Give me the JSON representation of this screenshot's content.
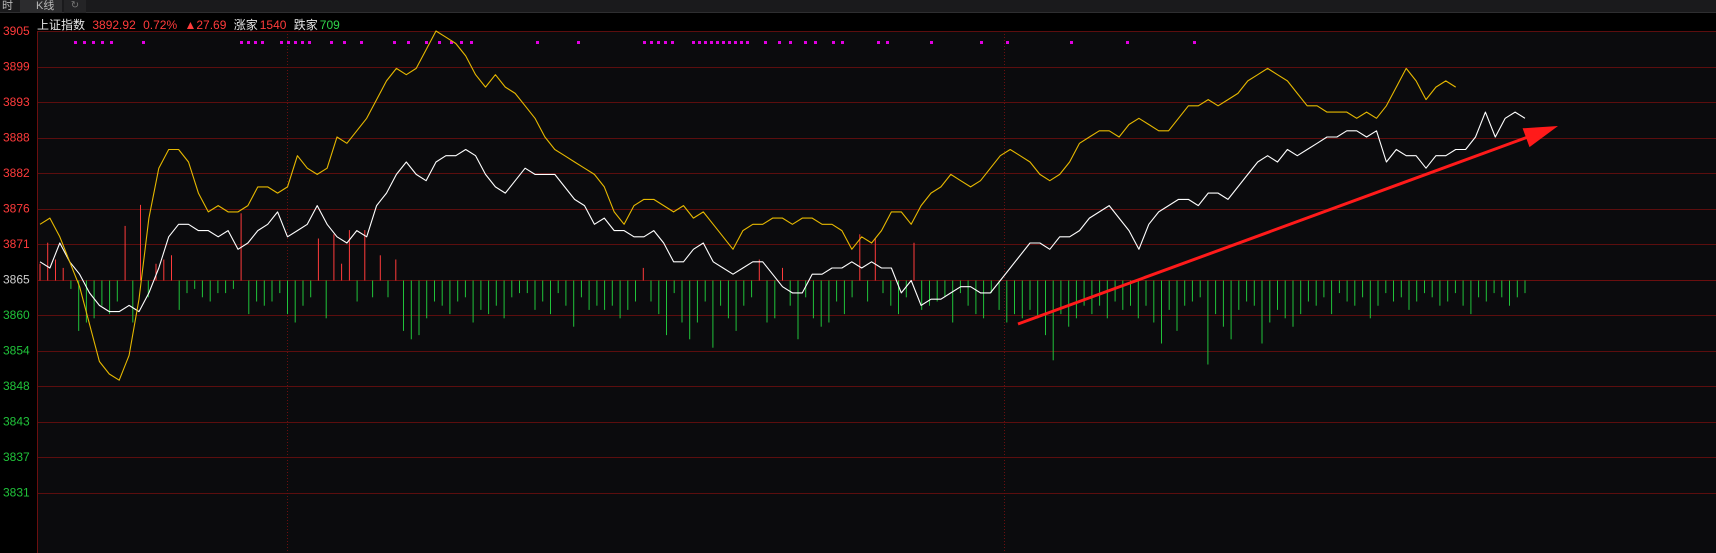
{
  "tabs": [
    {
      "label": "时"
    },
    {
      "label": "K线"
    },
    {
      "label": "↻"
    }
  ],
  "header": {
    "index_name": "上证指数",
    "price": "3892.92",
    "change_pct": "0.72%",
    "change_pts": "▲27.69",
    "advancers_label": "涨家",
    "advancers": "1540",
    "decliners_label": "跌家",
    "decliners": "709"
  },
  "colors": {
    "background": "#0b0b0d",
    "grid": "#6b0f0f",
    "up": "#ff3b3b",
    "down": "#20c33a",
    "price_line": "#ffffff",
    "avg_line": "#e6b800",
    "signal_dots": "#e000e0",
    "arrow": "#ff1a1a"
  },
  "chart_data": {
    "type": "line",
    "y_ticks": [
      "3905",
      "3899",
      "3893",
      "3888",
      "3882",
      "3876",
      "3871",
      "3865",
      "3860",
      "3854",
      "3848",
      "3843",
      "3837",
      "3831"
    ],
    "ylim": [
      3831,
      3905
    ],
    "reference": 3865,
    "series": [
      {
        "role": "price",
        "color": "white",
        "values": [
          3868,
          3867,
          3871,
          3868,
          3866,
          3863,
          3861,
          3860,
          3860,
          3861,
          3860,
          3863,
          3867,
          3872,
          3874,
          3874,
          3873,
          3873,
          3872,
          3873,
          3870,
          3871,
          3873,
          3874,
          3876,
          3872,
          3873,
          3874,
          3877,
          3874,
          3872,
          3871,
          3873,
          3872,
          3877,
          3879,
          3882,
          3884,
          3882,
          3881,
          3884,
          3885,
          3885,
          3886,
          3885,
          3882,
          3880,
          3879,
          3881,
          3883,
          3882,
          3882,
          3882,
          3880,
          3878,
          3877,
          3874,
          3875,
          3873,
          3873,
          3872,
          3872,
          3873,
          3871,
          3868,
          3868,
          3870,
          3871,
          3868,
          3867,
          3866,
          3867,
          3868,
          3868,
          3866,
          3864,
          3863,
          3863,
          3866,
          3866,
          3867,
          3867,
          3868,
          3867,
          3868,
          3867,
          3867,
          3863,
          3865,
          3861,
          3862,
          3862,
          3863,
          3864,
          3864,
          3863,
          3863,
          3865,
          3867,
          3869,
          3871,
          3871,
          3870,
          3872,
          3872,
          3873,
          3875,
          3876,
          3877,
          3875,
          3873,
          3870,
          3874,
          3876,
          3877,
          3878,
          3878,
          3877,
          3879,
          3879,
          3878,
          3880,
          3882,
          3884,
          3885,
          3884,
          3886,
          3885,
          3886,
          3887,
          3888,
          3888,
          3889,
          3889,
          3888,
          3889,
          3884,
          3886,
          3885,
          3885,
          3883,
          3885,
          3885,
          3886,
          3886,
          3888,
          3892,
          3888,
          3891,
          3892,
          3891
        ]
      },
      {
        "role": "average",
        "color": "yellow",
        "values": [
          3874,
          3875,
          3872,
          3868,
          3864,
          3858,
          3852,
          3850,
          3849,
          3853,
          3862,
          3875,
          3883,
          3886,
          3886,
          3884,
          3879,
          3876,
          3877,
          3876,
          3876,
          3877,
          3880,
          3880,
          3879,
          3880,
          3885,
          3883,
          3882,
          3883,
          3888,
          3887,
          3889,
          3891,
          3894,
          3897,
          3899,
          3898,
          3899,
          3902,
          3905,
          3904,
          3903,
          3901,
          3898,
          3896,
          3898,
          3896,
          3895,
          3893,
          3891,
          3888,
          3886,
          3885,
          3884,
          3883,
          3882,
          3880,
          3876,
          3874,
          3877,
          3878,
          3878,
          3877,
          3876,
          3877,
          3875,
          3876,
          3874,
          3872,
          3870,
          3873,
          3874,
          3874,
          3875,
          3875,
          3874,
          3875,
          3875,
          3874,
          3874,
          3873,
          3870,
          3872,
          3871,
          3873,
          3876,
          3876,
          3874,
          3877,
          3879,
          3880,
          3882,
          3881,
          3880,
          3881,
          3883,
          3885,
          3886,
          3885,
          3884,
          3882,
          3881,
          3882,
          3884,
          3887,
          3888,
          3889,
          3889,
          3888,
          3890,
          3891,
          3890,
          3889,
          3889,
          3891,
          3893,
          3893,
          3894,
          3893,
          3894,
          3895,
          3897,
          3898,
          3899,
          3898,
          3897,
          3895,
          3893,
          3893,
          3892,
          3892,
          3892,
          3891,
          3892,
          3891,
          3893,
          3896,
          3899,
          3897,
          3894,
          3896,
          3897,
          3896
        ]
      }
    ],
    "volume_bars": [
      4,
      9,
      5,
      3,
      -2,
      -12,
      -10,
      -9,
      -6,
      -8,
      -5,
      13,
      -10,
      18,
      -4,
      4,
      5,
      6,
      -7,
      -3,
      -2,
      -4,
      -5,
      -3,
      -3,
      -2,
      16,
      -8,
      -5,
      -6,
      -5,
      -3,
      -8,
      -10,
      -6,
      -4,
      10,
      -9,
      11,
      4,
      12,
      -5,
      12,
      -4,
      6,
      -4,
      5,
      -12,
      -14,
      -13,
      -9,
      -5,
      -6,
      -8,
      -5,
      -4,
      -10,
      -7,
      -8,
      -6,
      -9,
      -4,
      -3,
      -3,
      -7,
      -5,
      -8,
      -3,
      -6,
      -11,
      -4,
      -7,
      -6,
      -7,
      -6,
      -9,
      -7,
      -5,
      3,
      -5,
      -8,
      -13,
      -3,
      -10,
      -14,
      -10,
      -5,
      -16,
      -6,
      -9,
      -12,
      -6,
      -4,
      5,
      -10,
      -9,
      3,
      -6,
      -14,
      -4,
      -9,
      -11,
      -10,
      -5,
      -8,
      -4,
      11,
      -5,
      10,
      -3,
      -6,
      -8,
      -4,
      9,
      -7,
      -6,
      -5,
      -4,
      -10,
      -3,
      -6,
      -8,
      -9,
      -3,
      -7,
      -10,
      -8,
      -9,
      -7,
      -9,
      -13,
      -19,
      -8,
      -11,
      -9,
      -6,
      -8,
      -6,
      -9,
      -5,
      -7,
      -6,
      -9,
      -6,
      -10,
      -15,
      -7,
      -12,
      -6,
      -5,
      -4,
      -20,
      -8,
      -11,
      -14,
      -7,
      -5,
      -6,
      -15,
      -10,
      -7,
      -9,
      -11,
      -8,
      -5,
      -6,
      -4,
      -8,
      -3,
      -5,
      -6,
      -4,
      -9,
      -6,
      -3,
      -5,
      -4,
      -7,
      -5,
      -3,
      -4,
      -6,
      -5,
      -3,
      -6,
      -8,
      -4,
      -5,
      -3,
      -4,
      -6,
      -4,
      -3
    ]
  }
}
